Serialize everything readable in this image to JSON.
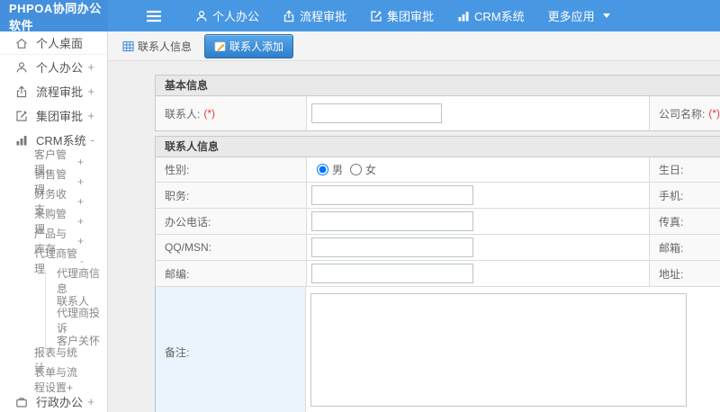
{
  "header": {
    "title": "PHPOA协同办公软件",
    "nav": [
      {
        "label": "个人办公",
        "icon": "user-icon"
      },
      {
        "label": "流程审批",
        "icon": "share-up-icon"
      },
      {
        "label": "集团审批",
        "icon": "edit-square-icon"
      },
      {
        "label": "CRM系统",
        "icon": "bar-chart-icon"
      },
      {
        "label": "更多应用",
        "icon": "caret-down-icon"
      }
    ]
  },
  "sidebar": {
    "items": [
      {
        "label": "个人桌面",
        "icon": "home-icon",
        "mark": ""
      },
      {
        "label": "个人办公",
        "icon": "user-icon",
        "mark": "+"
      },
      {
        "label": "流程审批",
        "icon": "share-up-icon",
        "mark": "+"
      },
      {
        "label": "集团审批",
        "icon": "edit-square-icon",
        "mark": "+"
      },
      {
        "label": "CRM系统",
        "icon": "bar-chart-icon",
        "mark": "-"
      },
      {
        "label": "客户管理",
        "mark": "+"
      },
      {
        "label": "销售管理",
        "mark": "+"
      },
      {
        "label": "财务收支",
        "mark": "+"
      },
      {
        "label": "采购管理",
        "mark": "+"
      },
      {
        "label": "产品与库存",
        "mark": "+"
      },
      {
        "label": "代理商管理",
        "mark": "-"
      },
      {
        "label": "代理商信息",
        "mark": ""
      },
      {
        "label": "联系人",
        "mark": ""
      },
      {
        "label": "代理商投诉",
        "mark": ""
      },
      {
        "label": "客户关怀",
        "mark": ""
      },
      {
        "label": "报表与统计",
        "mark": ""
      },
      {
        "label": "表单与流程设置+",
        "mark": ""
      },
      {
        "label": "行政办公",
        "icon": "briefcase-icon",
        "mark": "+"
      }
    ]
  },
  "tabs": [
    {
      "label": "联系人信息",
      "icon": "table-icon",
      "active": false
    },
    {
      "label": "联系人添加",
      "icon": "edit-pencil-icon",
      "active": true
    }
  ],
  "form": {
    "required_mark": "(*)",
    "sections": [
      {
        "title": "基本信息"
      },
      {
        "title": "联系人信息"
      }
    ],
    "rows": {
      "contact": {
        "label": "联系人:",
        "value": ""
      },
      "company": {
        "label": "公司名称:"
      },
      "gender": {
        "label": "性别:",
        "options": [
          "男",
          "女"
        ],
        "selected": "男",
        "right": "生日:"
      },
      "job": {
        "label": "职务:",
        "value": "",
        "right": "手机:"
      },
      "phone": {
        "label": "办公电话:",
        "value": "",
        "right": "传真:"
      },
      "qq": {
        "label": "QQ/MSN:",
        "value": "",
        "right": "邮箱:"
      },
      "zip": {
        "label": "邮编:",
        "value": "",
        "right": "地址:"
      },
      "note": {
        "label": "备注:",
        "value": ""
      }
    }
  }
}
